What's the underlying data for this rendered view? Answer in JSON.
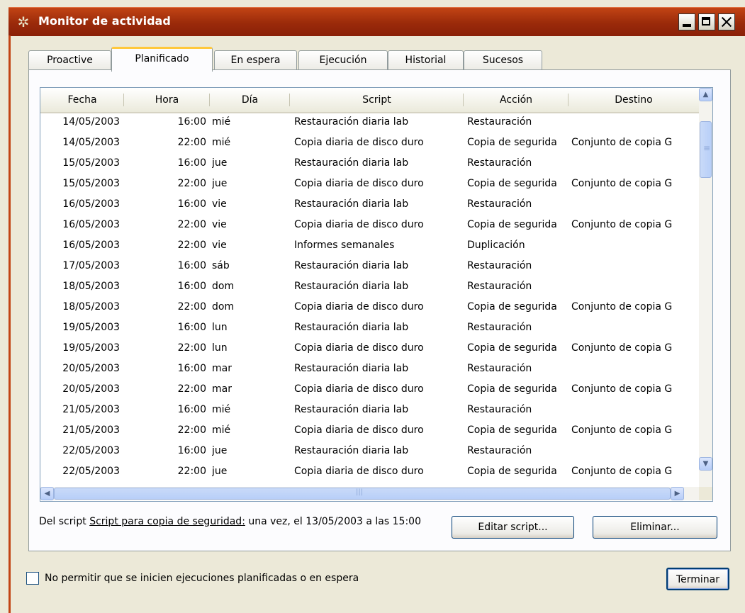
{
  "window": {
    "title": "Monitor de actividad",
    "icon": "gear-icon"
  },
  "tabs": [
    {
      "label": "Proactive",
      "active": false
    },
    {
      "label": "Planificado",
      "active": true
    },
    {
      "label": "En espera",
      "active": false
    },
    {
      "label": "Ejecución",
      "active": false
    },
    {
      "label": "Historial",
      "active": false
    },
    {
      "label": "Sucesos",
      "active": false
    }
  ],
  "table": {
    "columns": [
      "Fecha",
      "Hora",
      "Día",
      "Script",
      "Acción",
      "Destino"
    ],
    "rows": [
      [
        "14/05/2003",
        "16:00",
        "mié",
        "Restauración diaria lab",
        "Restauración",
        ""
      ],
      [
        "14/05/2003",
        "22:00",
        "mié",
        "Copia diaria de disco duro",
        "Copia de segurida",
        "Conjunto de copia G"
      ],
      [
        "15/05/2003",
        "16:00",
        "jue",
        "Restauración diaria lab",
        "Restauración",
        ""
      ],
      [
        "15/05/2003",
        "22:00",
        "jue",
        "Copia diaria de disco duro",
        "Copia de segurida",
        "Conjunto de copia G"
      ],
      [
        "16/05/2003",
        "16:00",
        "vie",
        "Restauración diaria lab",
        "Restauración",
        ""
      ],
      [
        "16/05/2003",
        "22:00",
        "vie",
        "Copia diaria de disco duro",
        "Copia de segurida",
        "Conjunto de copia G"
      ],
      [
        "16/05/2003",
        "22:00",
        "vie",
        "Informes semanales",
        "Duplicación",
        ""
      ],
      [
        "17/05/2003",
        "16:00",
        "sáb",
        "Restauración diaria lab",
        "Restauración",
        ""
      ],
      [
        "18/05/2003",
        "16:00",
        "dom",
        "Restauración diaria lab",
        "Restauración",
        ""
      ],
      [
        "18/05/2003",
        "22:00",
        "dom",
        "Copia diaria de disco duro",
        "Copia de segurida",
        "Conjunto de copia G"
      ],
      [
        "19/05/2003",
        "16:00",
        "lun",
        "Restauración diaria lab",
        "Restauración",
        ""
      ],
      [
        "19/05/2003",
        "22:00",
        "lun",
        "Copia diaria de disco duro",
        "Copia de segurida",
        "Conjunto de copia G"
      ],
      [
        "20/05/2003",
        "16:00",
        "mar",
        "Restauración diaria lab",
        "Restauración",
        ""
      ],
      [
        "20/05/2003",
        "22:00",
        "mar",
        "Copia diaria de disco duro",
        "Copia de segurida",
        "Conjunto de copia G"
      ],
      [
        "21/05/2003",
        "16:00",
        "mié",
        "Restauración diaria lab",
        "Restauración",
        ""
      ],
      [
        "21/05/2003",
        "22:00",
        "mié",
        "Copia diaria de disco duro",
        "Copia de segurida",
        "Conjunto de copia G"
      ],
      [
        "22/05/2003",
        "16:00",
        "jue",
        "Restauración diaria lab",
        "Restauración",
        ""
      ],
      [
        "22/05/2003",
        "22:00",
        "jue",
        "Copia diaria de disco duro",
        "Copia de segurida",
        "Conjunto de copia G"
      ]
    ]
  },
  "info": {
    "prefix": "Del script ",
    "link": "Script para copia de seguridad:",
    "suffix": " una vez, el 13/05/2003 a las 15:00"
  },
  "buttons": {
    "edit_script": "Editar script...",
    "delete": "Eliminar...",
    "finish": "Terminar"
  },
  "checkbox": {
    "label": "No permitir que se inicien ejecuciones planificadas o en espera",
    "checked": false
  },
  "colors": {
    "titlebar": "#9a2a0a",
    "tab_highlight": "#ffc83c",
    "face": "#ece9d8"
  }
}
